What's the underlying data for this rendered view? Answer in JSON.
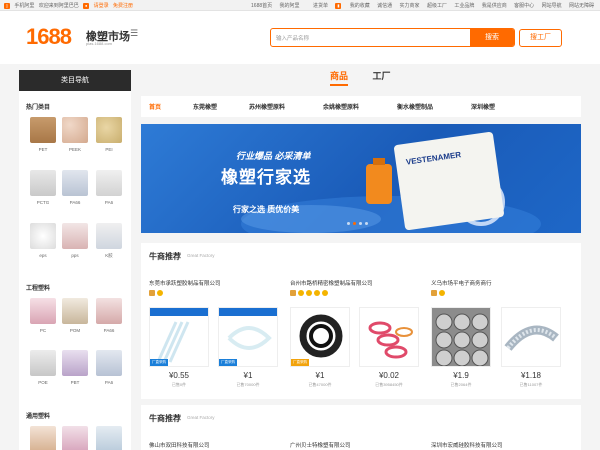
{
  "topbar": {
    "left": [
      "手机阿里",
      "欢迎来到阿里巴巴",
      "请登录",
      "免费注册"
    ],
    "right": [
      "1688首页",
      "我的阿里",
      "进货单",
      "我的收藏",
      "诚信通",
      "实力商家",
      "超级工厂",
      "工业品牌",
      "我是供应商",
      "客服中心",
      "网站导航",
      "网站无障碍"
    ]
  },
  "header": {
    "logo": "1688",
    "brand": "橡塑市场",
    "brand_sub": "plas.1688.com",
    "search_placeholder": "输入产品名称",
    "search_button": "搜索",
    "factory_button": "搜工厂"
  },
  "sidebar": {
    "title": "类目导航",
    "sections": [
      {
        "title": "热门类目",
        "items": [
          "PET",
          "PEEK",
          "PEI",
          "PCTG",
          "PA66",
          "PA6",
          "eps",
          "pps",
          "K胶"
        ]
      },
      {
        "title": "工程塑料",
        "items": [
          "PC",
          "POM",
          "PA66",
          "POE",
          "PBT",
          "PA6"
        ]
      },
      {
        "title": "通用塑料",
        "items": []
      }
    ]
  },
  "main_tabs": [
    "商品",
    "工厂"
  ],
  "subnav": [
    "首页",
    "东莞橡塑",
    "苏州橡塑原料",
    "余姚橡塑原料",
    "衡水橡塑制品",
    "深圳橡塑"
  ],
  "banner": {
    "line1": "行业爆品 必采清单",
    "line2": "橡塑行家选",
    "line3": "行家之选  质优价美",
    "bag_text": "VESTENAMER"
  },
  "section1": {
    "title": "牛商推荐",
    "subtitle": "Great Factory",
    "companies": [
      {
        "name": "东莞市承跃塑胶制品有限公司",
        "products": [
          {
            "price": "¥0.55",
            "sold": "已售0件"
          },
          {
            "price": "¥1",
            "sold": "已售70000件"
          }
        ]
      },
      {
        "name": "台州市路桥精密橡塑制品有限公司",
        "products": [
          {
            "price": "¥1",
            "sold": "已售47000件"
          },
          {
            "price": "¥0.02",
            "sold": "已售3958450件"
          }
        ]
      },
      {
        "name": "义乌市场平电子商务商行",
        "products": [
          {
            "price": "¥1.9",
            "sold": "已售2064件"
          },
          {
            "price": "¥1.18",
            "sold": "已售11007件"
          }
        ]
      }
    ]
  },
  "section2": {
    "title": "牛商推荐",
    "subtitle": "Great Factory",
    "companies": [
      "佛山市双田科技有限公司",
      "广州贝士特橡塑有限公司",
      "深圳市宏威硅胶科技有限公司"
    ]
  },
  "badge_text": "厂直采购",
  "colors": {
    "accent": "#ff6a00",
    "dark": "#2b2b2b",
    "banner": "#1f63c6"
  }
}
